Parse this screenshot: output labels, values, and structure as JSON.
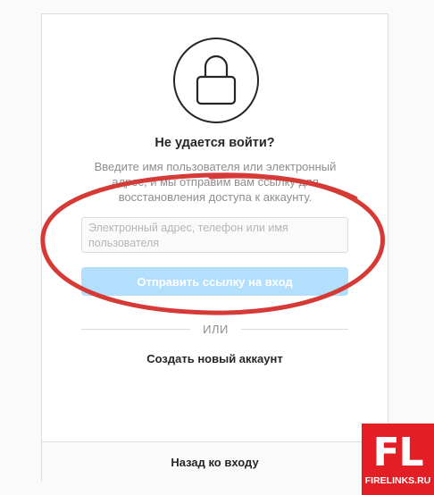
{
  "reset": {
    "icon": "lock-icon",
    "title": "Не удается войти?",
    "description": "Введите имя пользователя или электронный адрес, и мы отправим вам ссылку для восстановления доступа к аккаунту.",
    "input_placeholder": "Электронный адрес, телефон или имя пользователя",
    "input_value": "",
    "submit_label": "Отправить ссылку на вход",
    "or_label": "ИЛИ",
    "create_account_label": "Создать новый аккаунт",
    "back_label": "Назад ко входу"
  },
  "annotation": {
    "shape": "ellipse",
    "color": "#d63a36"
  },
  "watermark": {
    "logo_text": "FL",
    "site": "FIRELINKS.RU",
    "color": "#e31e24"
  },
  "colors": {
    "button_disabled": "#b2dffc",
    "text_primary": "#262626",
    "text_secondary": "#8e8e8e",
    "border": "#dbdbdb"
  }
}
